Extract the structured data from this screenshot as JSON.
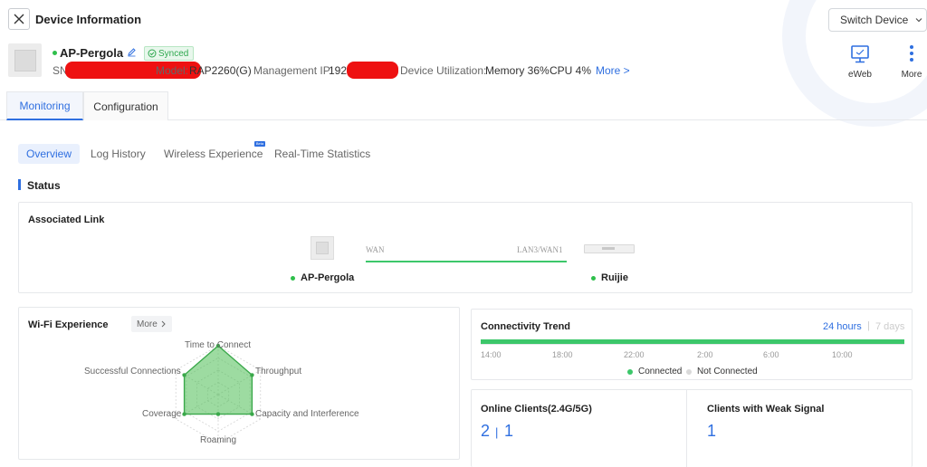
{
  "header": {
    "title": "Device Information",
    "switch_label": "Switch Device",
    "close_icon": "close-icon"
  },
  "device": {
    "name": "AP-Pergola",
    "status": "online",
    "synced_label": "Synced",
    "sn_label": "SN",
    "model_label": "Model:",
    "model_value": "RAP2260(G)",
    "mgmt_ip_label": "Management IP:",
    "mgmt_ip_value": "192.",
    "utilization_label": "Device Utilization:",
    "memory": "Memory 36%",
    "cpu": "CPU 4%",
    "more_link": "More >"
  },
  "top_actions": [
    {
      "label": "eWeb",
      "icon": "monitor-icon"
    },
    {
      "label": "More",
      "icon": "vertical-dots-icon"
    }
  ],
  "main_tabs": [
    {
      "label": "Monitoring",
      "active": true
    },
    {
      "label": "Configuration",
      "active": false
    }
  ],
  "sub_tabs": [
    {
      "label": "Overview",
      "active": true
    },
    {
      "label": "Log History",
      "active": false
    },
    {
      "label": "Wireless Experience",
      "active": false,
      "badge": "Beta"
    },
    {
      "label": "Real-Time Statistics",
      "active": false
    }
  ],
  "status": {
    "section_title": "Status",
    "associated_link": {
      "title": "Associated Link",
      "local_port": "WAN",
      "remote_port": "LAN3/WAN1",
      "local_device": "AP-Pergola",
      "remote_device": "Ruijie"
    },
    "wifi_experience": {
      "title": "Wi-Fi Experience",
      "more_label": "More",
      "axes": [
        "Time to Connect",
        "Throughput",
        "Capacity and Interference",
        "Roaming",
        "Coverage",
        "Successful Connections"
      ],
      "levels": [
        1.0,
        0.8,
        0.8,
        0.4,
        0.8,
        0.8
      ]
    },
    "connectivity_trend": {
      "title": "Connectivity Trend",
      "range_options": [
        "24 hours",
        "7 days"
      ],
      "active_range": "24 hours",
      "time_ticks": [
        "14:00",
        "18:00",
        "22:00",
        "2:00",
        "6:00",
        "10:00"
      ],
      "legend": [
        {
          "label": "Connected",
          "color": "#3cc76a"
        },
        {
          "label": "Not Connected",
          "color": "#d9d9d9"
        }
      ]
    },
    "online_clients": {
      "title": "Online Clients(2.4G/5G)",
      "value_24g": "2",
      "value_5g": "1"
    },
    "weak_signal": {
      "title": "Clients with Weak Signal",
      "value": "1"
    }
  },
  "colors": {
    "accent": "#2f6fe0",
    "online": "#2fbf4b",
    "connected": "#3cc76a",
    "redaction": "#ee1111"
  }
}
